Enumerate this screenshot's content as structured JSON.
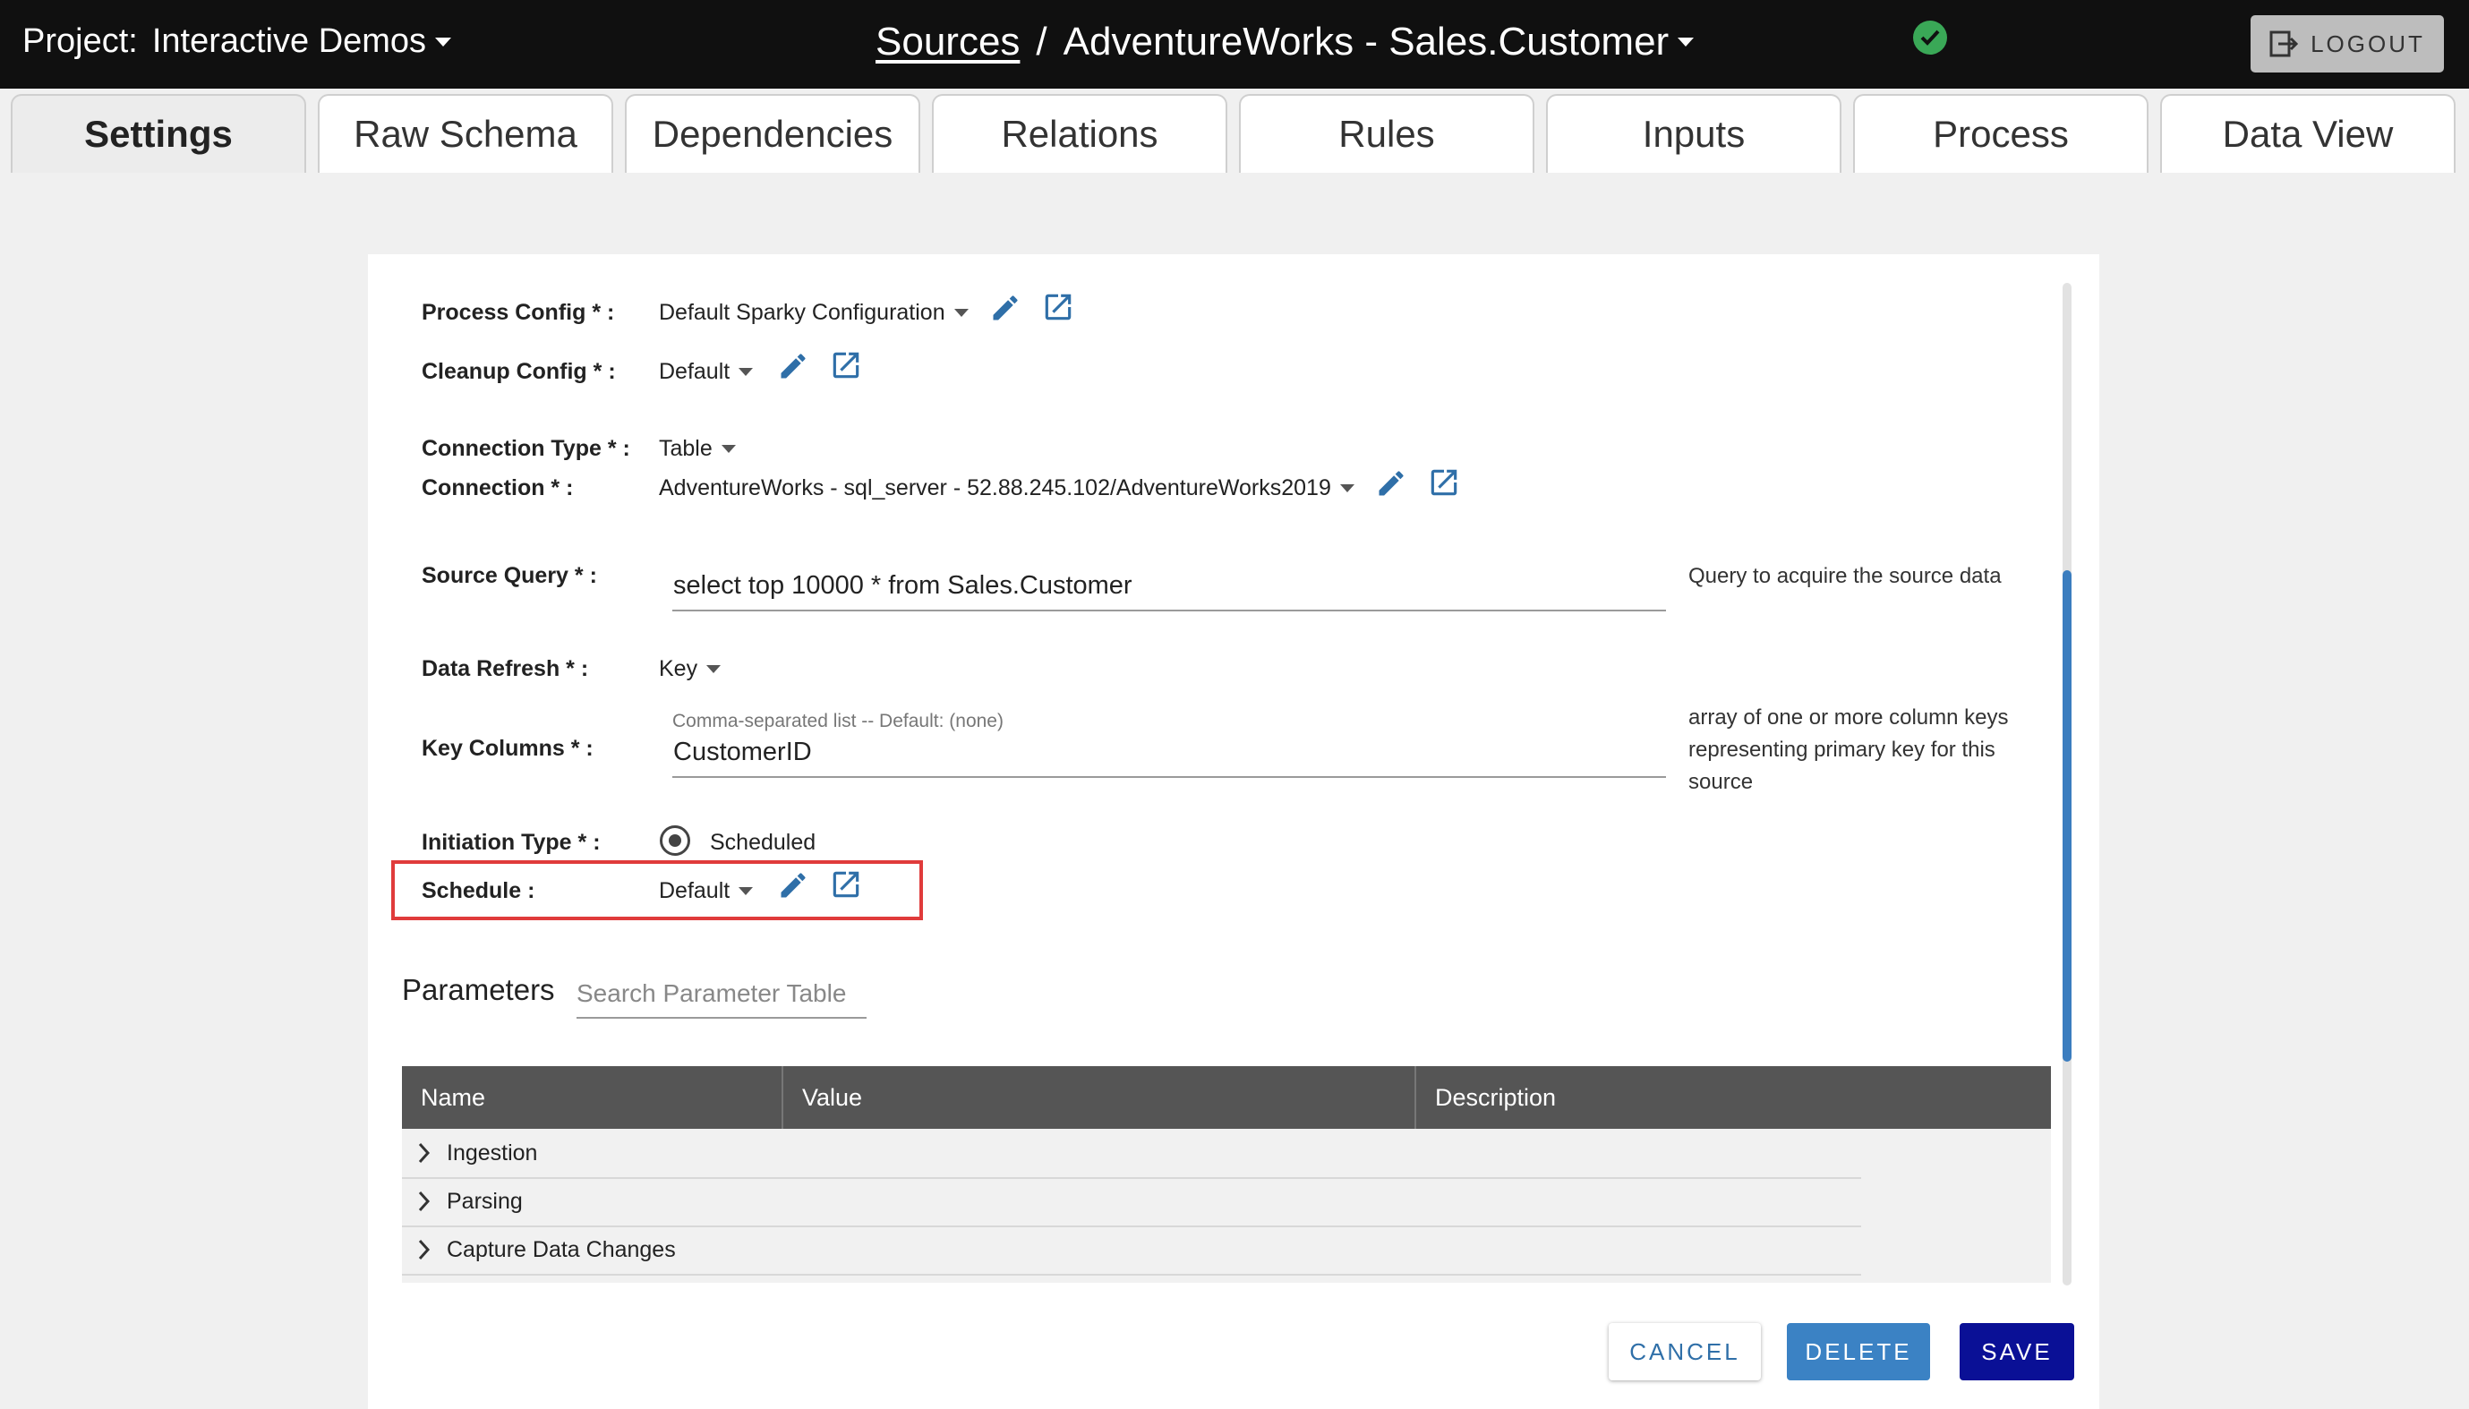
{
  "header": {
    "project_label": "Project:",
    "project_name": "Interactive Demos",
    "breadcrumb_root": "Sources",
    "breadcrumb_sep": "/",
    "breadcrumb_current": "AdventureWorks - Sales.Customer",
    "logout_label": "LOGOUT"
  },
  "tabs": [
    {
      "label": "Settings",
      "active": true
    },
    {
      "label": "Raw Schema"
    },
    {
      "label": "Dependencies"
    },
    {
      "label": "Relations"
    },
    {
      "label": "Rules"
    },
    {
      "label": "Inputs"
    },
    {
      "label": "Process"
    },
    {
      "label": "Data View"
    }
  ],
  "form": {
    "process_config": {
      "label": "Process Config * :",
      "value": "Default Sparky Configuration"
    },
    "cleanup_config": {
      "label": "Cleanup Config * :",
      "value": "Default"
    },
    "connection_type": {
      "label": "Connection Type * :",
      "value": "Table"
    },
    "connection": {
      "label": "Connection * :",
      "value": "AdventureWorks - sql_server - 52.88.245.102/AdventureWorks2019"
    },
    "source_query": {
      "label": "Source Query * :",
      "value": "select top 10000 * from Sales.Customer",
      "help": "Query to acquire the source data"
    },
    "data_refresh": {
      "label": "Data Refresh * :",
      "value": "Key"
    },
    "key_columns": {
      "label": "Key Columns * :",
      "hint": "Comma-separated list -- Default: (none)",
      "value": "CustomerID",
      "help": "array of one or more column keys representing primary key for this source"
    },
    "initiation_type": {
      "label": "Initiation Type * :",
      "value": "Scheduled"
    },
    "schedule": {
      "label": "Schedule :",
      "value": "Default"
    }
  },
  "parameters": {
    "title": "Parameters",
    "search_placeholder": "Search Parameter Table",
    "columns": [
      "Name",
      "Value",
      "Description"
    ],
    "rows": [
      "Ingestion",
      "Parsing",
      "Capture Data Changes"
    ]
  },
  "actions": {
    "cancel": "CANCEL",
    "delete": "DELETE",
    "save": "SAVE"
  },
  "colors": {
    "accent_blue": "#3b7dbf",
    "save_navy": "#0a1096",
    "highlight_red": "#e03b3b",
    "status_green": "#3aa857"
  }
}
